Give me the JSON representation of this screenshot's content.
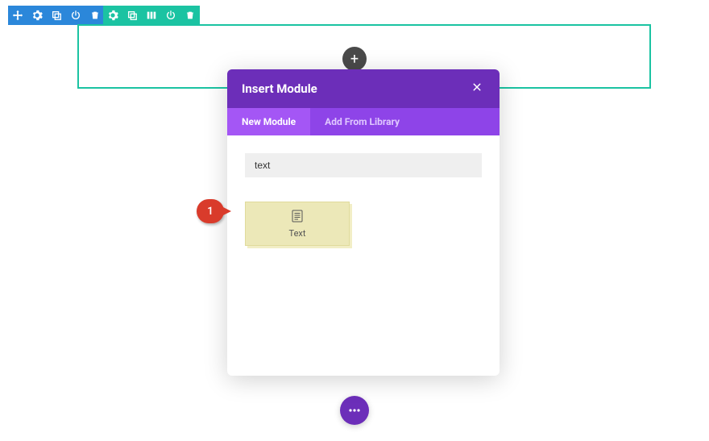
{
  "modal": {
    "title": "Insert Module",
    "tabs": {
      "new": "New Module",
      "library": "Add From Library"
    },
    "search_value": "text",
    "module_label": "Text"
  },
  "callout": {
    "number": "1"
  },
  "add_button": {
    "symbol": "+"
  },
  "float_button": {
    "symbol": "⋯"
  }
}
